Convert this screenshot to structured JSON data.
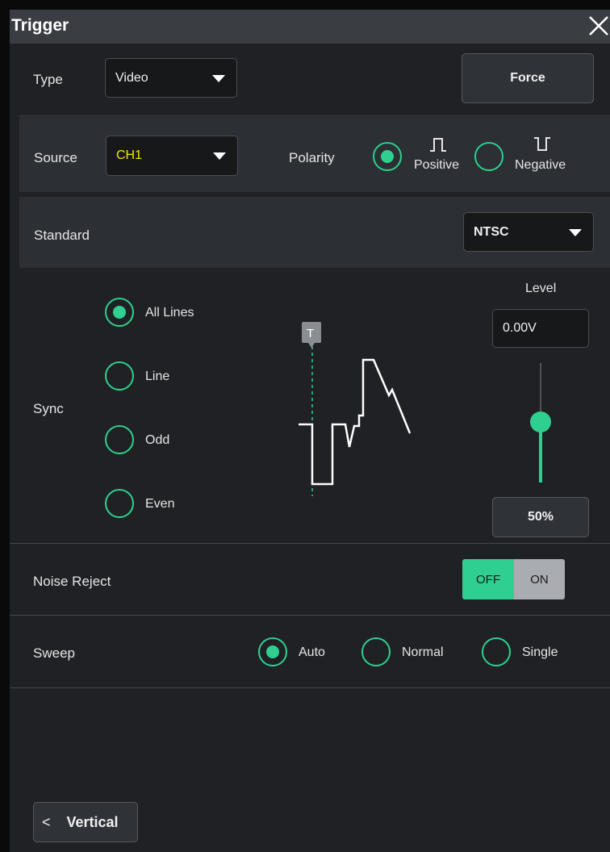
{
  "dialog": {
    "title": "Trigger"
  },
  "type": {
    "label": "Type",
    "value": "Video"
  },
  "force_label": "Force",
  "source": {
    "label": "Source",
    "value": "CH1",
    "value_color": "#f2e600"
  },
  "polarity": {
    "label": "Polarity",
    "options": [
      {
        "label": "Positive",
        "selected": true
      },
      {
        "label": "Negative",
        "selected": false
      }
    ]
  },
  "standard": {
    "label": "Standard",
    "value": "NTSC"
  },
  "sync": {
    "label": "Sync",
    "options": [
      {
        "label": "All Lines",
        "selected": true
      },
      {
        "label": "Line",
        "selected": false
      },
      {
        "label": "Odd",
        "selected": false
      },
      {
        "label": "Even",
        "selected": false
      }
    ]
  },
  "trigger_marker": "T",
  "level": {
    "label": "Level",
    "value": "0.00V",
    "percent_label": "50%",
    "slider_fraction": 0.5
  },
  "noise_reject": {
    "label": "Noise Reject",
    "off_label": "OFF",
    "on_label": "ON",
    "state": "OFF"
  },
  "sweep": {
    "label": "Sweep",
    "options": [
      {
        "label": "Auto",
        "selected": true
      },
      {
        "label": "Normal",
        "selected": false
      },
      {
        "label": "Single",
        "selected": false
      }
    ]
  },
  "back_button": {
    "label": "Vertical"
  },
  "colors": {
    "accent": "#2fd08f",
    "panel": "#202124",
    "row": "#2c2f33",
    "title_bar": "#3a3d42"
  }
}
